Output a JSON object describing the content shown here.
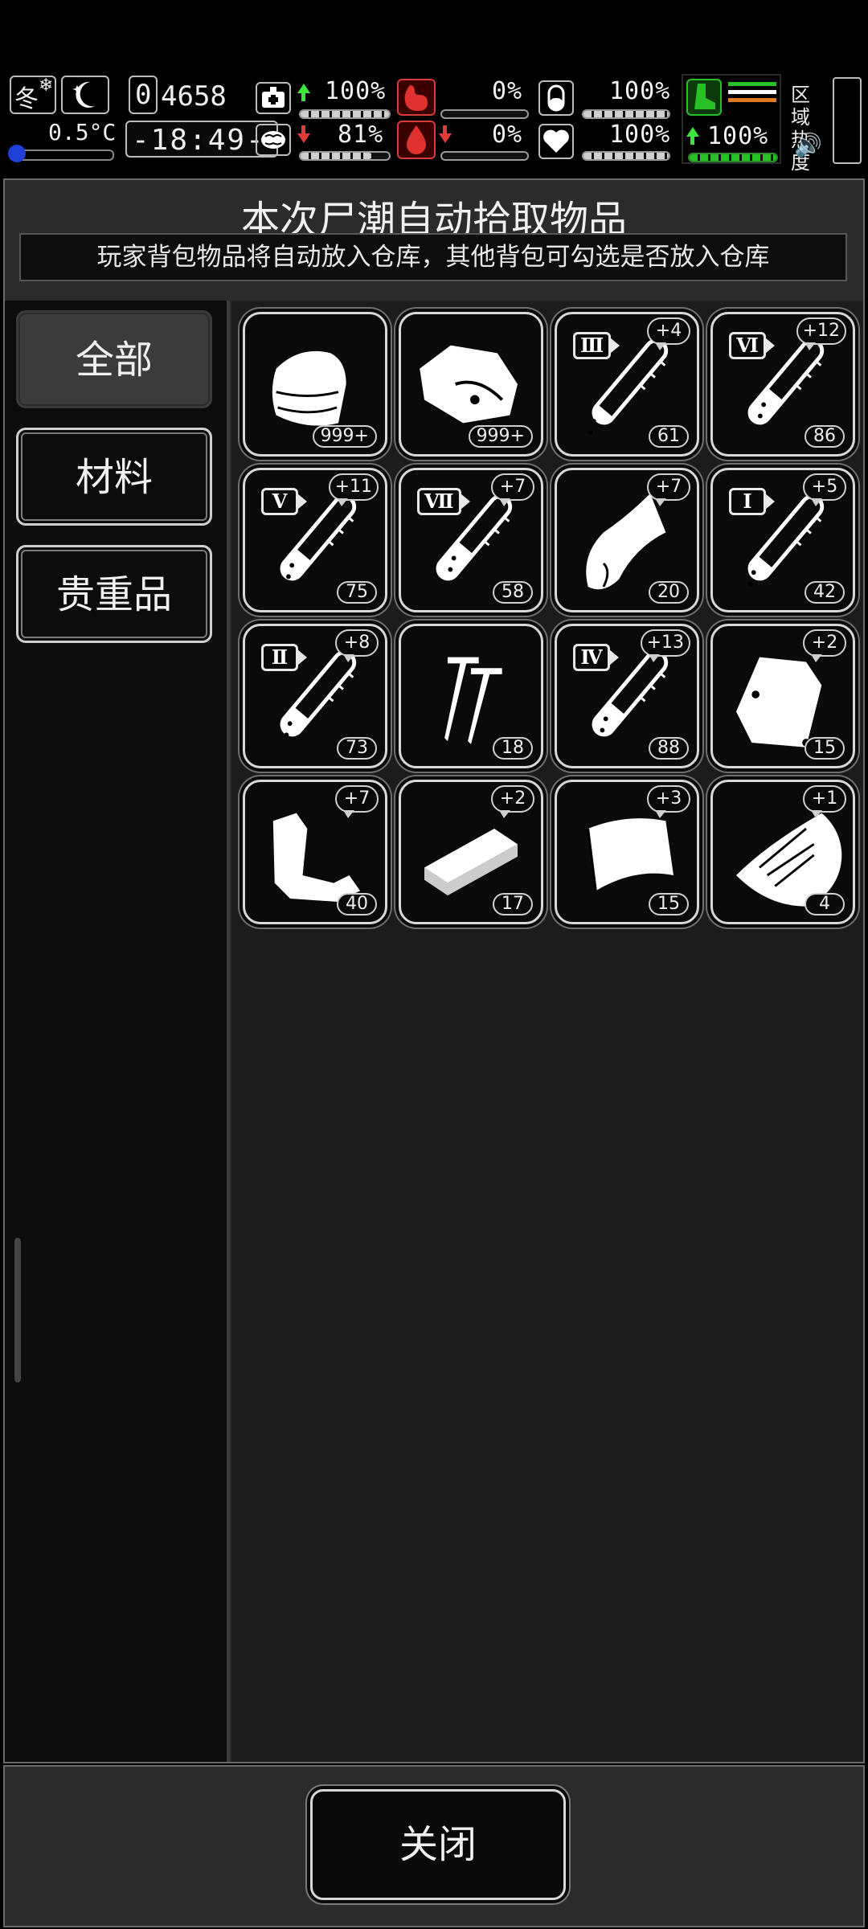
{
  "status": {
    "season": "冬",
    "temperature": "0.5°C",
    "day_digit": "0",
    "days": "4658",
    "time": "-18:49-",
    "stats_row1": [
      {
        "name": "health",
        "value": "100%",
        "trend": "up",
        "level": 1.0
      },
      {
        "name": "hunger",
        "value": "0%",
        "trend": "none",
        "level": 0.0
      },
      {
        "name": "stamina",
        "value": "100%",
        "trend": "none",
        "level": 1.0
      }
    ],
    "stats_row2": [
      {
        "name": "sanity",
        "value": "81%",
        "trend": "down",
        "level": 0.81
      },
      {
        "name": "thirst",
        "value": "0%",
        "trend": "down",
        "level": 0.0
      },
      {
        "name": "mood",
        "value": "100%",
        "trend": "none",
        "level": 1.0
      }
    ],
    "speed": {
      "value": "100%",
      "trend": "up",
      "level": 1.0
    },
    "zone_heat_label": "区域热度",
    "colors": {
      "green": "#27c027",
      "red": "#e23b3b",
      "orange": "#e07a1f"
    }
  },
  "dialog": {
    "title": "本次尸潮自动拾取物品",
    "subtitle": "玩家背包物品将自动放入仓库，其他背包可勾选是否放入仓库",
    "tabs": [
      {
        "label": "全部",
        "active": true
      },
      {
        "label": "材料",
        "active": false
      },
      {
        "label": "贵重品",
        "active": false
      }
    ],
    "items": [
      {
        "icon": "cloth-icon",
        "qty": "999+",
        "bonus": "",
        "roman": ""
      },
      {
        "icon": "meat-icon",
        "qty": "999+",
        "bonus": "",
        "roman": ""
      },
      {
        "icon": "test-tube-icon",
        "qty": "61",
        "bonus": "+4",
        "roman": "Ⅲ",
        "fill": 0.2
      },
      {
        "icon": "test-tube-icon",
        "qty": "86",
        "bonus": "+12",
        "roman": "Ⅵ",
        "fill": 0.55
      },
      {
        "icon": "test-tube-icon",
        "qty": "75",
        "bonus": "+11",
        "roman": "Ⅴ",
        "fill": 0.45
      },
      {
        "icon": "test-tube-icon",
        "qty": "58",
        "bonus": "+7",
        "roman": "Ⅶ",
        "fill": 0.6
      },
      {
        "icon": "leather-icon",
        "qty": "20",
        "bonus": "+7",
        "roman": ""
      },
      {
        "icon": "test-tube-icon",
        "qty": "42",
        "bonus": "+5",
        "roman": "Ⅰ",
        "fill": 0.3
      },
      {
        "icon": "test-tube-icon",
        "qty": "73",
        "bonus": "+8",
        "roman": "Ⅱ",
        "fill": 0.4
      },
      {
        "icon": "nails-icon",
        "qty": "18",
        "bonus": "",
        "roman": ""
      },
      {
        "icon": "test-tube-icon",
        "qty": "88",
        "bonus": "+13",
        "roman": "Ⅳ",
        "fill": 0.5
      },
      {
        "icon": "bag-icon",
        "qty": "15",
        "bonus": "+2",
        "roman": ""
      },
      {
        "icon": "scrap-icon",
        "qty": "40",
        "bonus": "+7",
        "roman": ""
      },
      {
        "icon": "plank-icon",
        "qty": "17",
        "bonus": "+2",
        "roman": ""
      },
      {
        "icon": "sheet-icon",
        "qty": "15",
        "bonus": "+3",
        "roman": ""
      },
      {
        "icon": "bark-icon",
        "qty": "4",
        "bonus": "+1",
        "roman": ""
      }
    ],
    "close_label": "关闭"
  }
}
